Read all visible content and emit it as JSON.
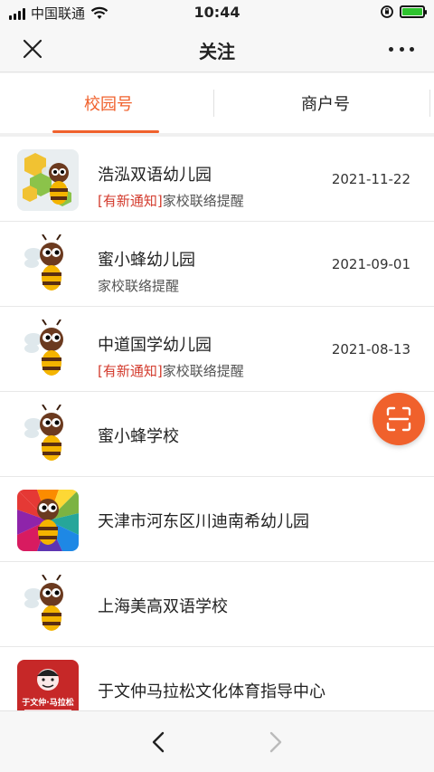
{
  "status_bar": {
    "carrier": "中国联通",
    "time": "10:44"
  },
  "nav": {
    "title": "关注",
    "close_icon": "close-icon",
    "more_icon": "more-icon"
  },
  "tabs": [
    {
      "label": "校园号",
      "active": true
    },
    {
      "label": "商户号",
      "active": false
    }
  ],
  "accent_color": "#f0612c",
  "notice_color": "#d33a2c",
  "items": [
    {
      "name": "浩泓双语幼儿园",
      "notice": "[有新通知]",
      "subtitle": "家校联络提醒",
      "date": "2021-11-22",
      "avatar": "honeycomb-bee"
    },
    {
      "name": "蜜小蜂幼儿园",
      "notice": "",
      "subtitle": "家校联络提醒",
      "date": "2021-09-01",
      "avatar": "bee"
    },
    {
      "name": "中道国学幼儿园",
      "notice": "[有新通知]",
      "subtitle": "家校联络提醒",
      "date": "2021-08-13",
      "avatar": "bee"
    },
    {
      "name": "蜜小蜂学校",
      "notice": "",
      "subtitle": "",
      "date": "",
      "avatar": "bee"
    },
    {
      "name": "天津市河东区川迪南希幼儿园",
      "notice": "",
      "subtitle": "",
      "date": "",
      "avatar": "rainbow-bee"
    },
    {
      "name": "上海美高双语学校",
      "notice": "",
      "subtitle": "",
      "date": "",
      "avatar": "bee"
    },
    {
      "name": "于文仲马拉松文化体育指导中心",
      "notice": "",
      "subtitle": "",
      "date": "",
      "avatar": "marathon-logo"
    }
  ],
  "marathon_logo_text": "于文仲·马拉松",
  "fab": {
    "icon": "scan-icon"
  },
  "bottom_nav": {
    "back_icon": "chevron-left-icon",
    "forward_icon": "chevron-right-icon"
  }
}
